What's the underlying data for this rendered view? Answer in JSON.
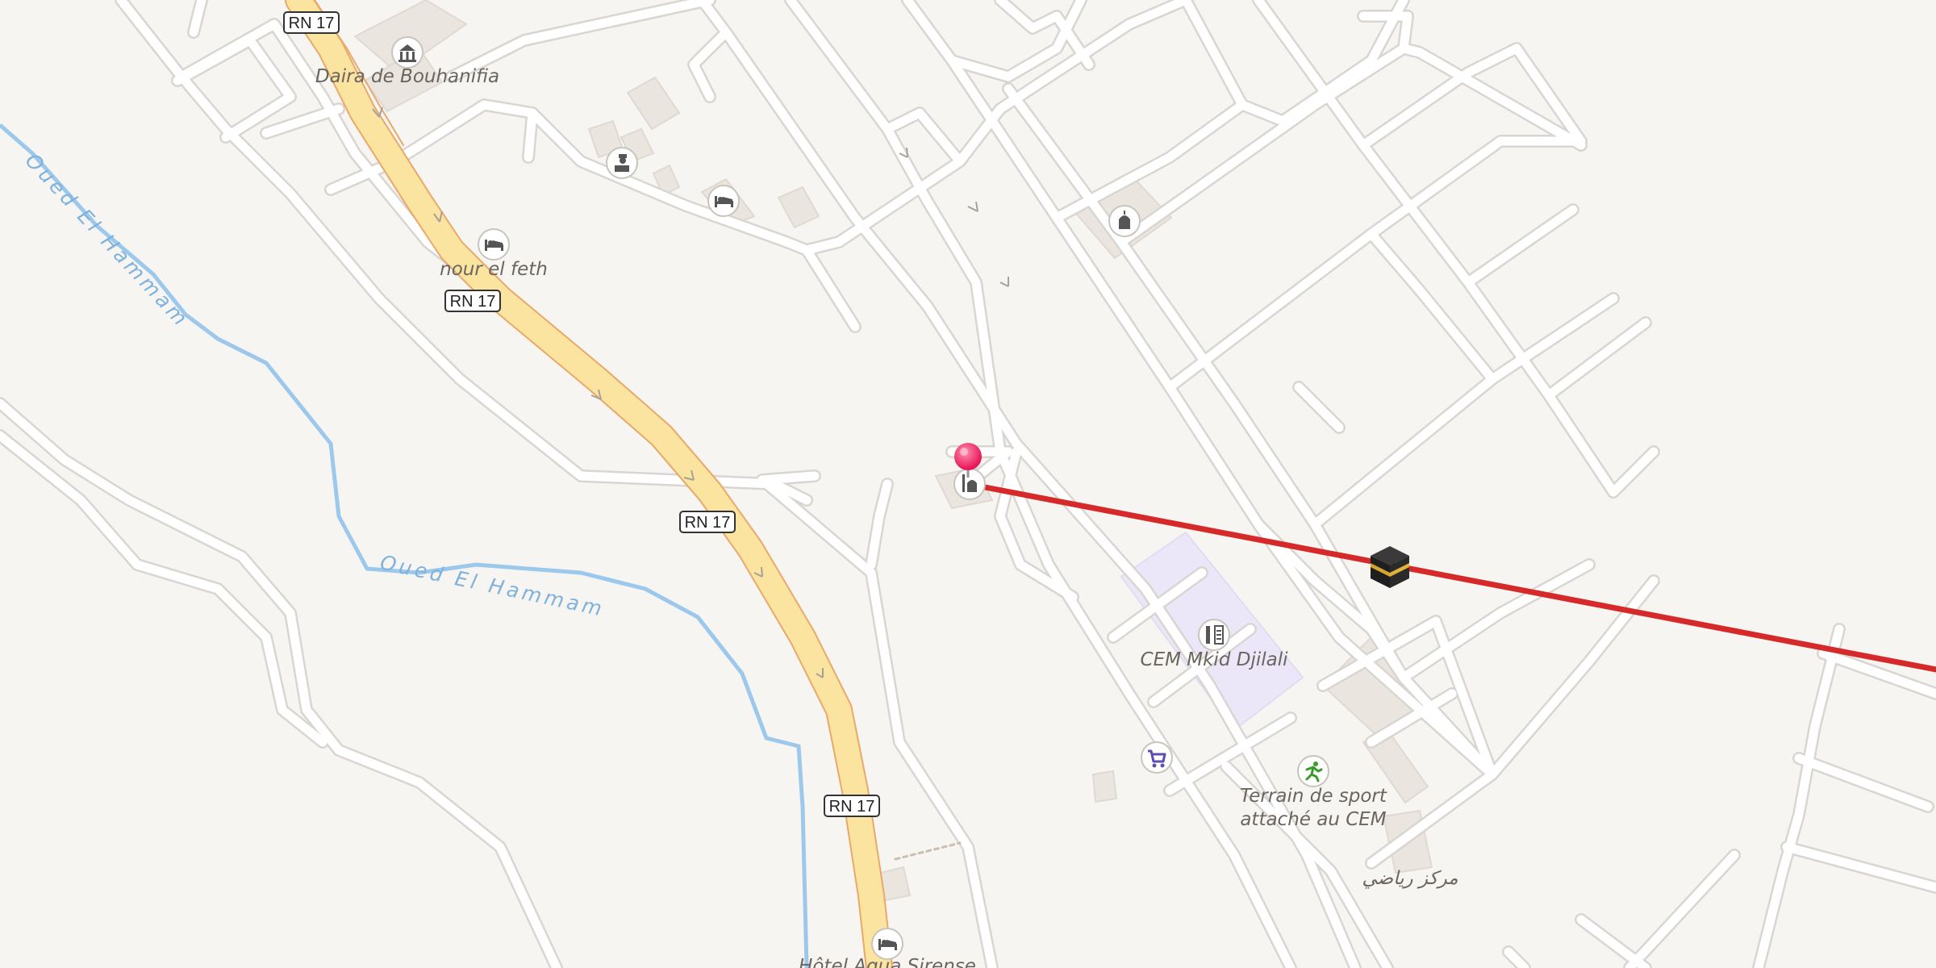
{
  "map": {
    "colors": {
      "background": "#f7f5f2",
      "street": "#ffffff",
      "street_casing": "#d9d6d2",
      "highway_fill": "#fbe3a0",
      "highway_casing": "#e8a96a",
      "river": "#9cc8ec",
      "building": "#ebe5df",
      "school_area": "#ece7f8",
      "route_line": "#d62a2a",
      "pin": "#e8185a"
    },
    "road_shields": [
      "RN 17",
      "RN 17",
      "RN 17",
      "RN 17"
    ],
    "labels": {
      "daira": "Daira de Bouhanifia",
      "nour": "nour el feth",
      "cem": "CEM Mkid Djilali",
      "terrain_line1": "Terrain de sport",
      "terrain_line2": "attaché au CEM",
      "arabic": "مركز رياضي",
      "hotel": "Hôtel Aqua Sirense"
    },
    "rivers": {
      "upper": "Oued El Hammam",
      "lower": "Oued El Hammam"
    },
    "icons": [
      "town-hall-icon",
      "police-icon",
      "hotel-icon",
      "hotel-icon",
      "place-of-worship-icon",
      "mosque-icon",
      "school-icon",
      "supermarket-icon",
      "sports-center-icon",
      "hotel-icon",
      "kaaba-icon"
    ]
  }
}
